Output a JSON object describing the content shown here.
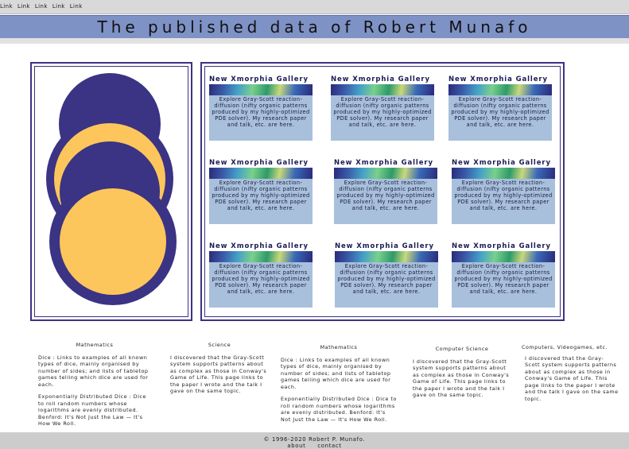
{
  "nav": {
    "links": [
      "Link",
      "Link",
      "Link",
      "Link",
      "Link"
    ]
  },
  "header": {
    "title": "The published data of Robert Munafo"
  },
  "palette": {
    "navy": "#3b3383",
    "gold": "#fcc65c",
    "banner": "#7e92c6",
    "card": "#a8c0dc"
  },
  "gallery": {
    "cards": [
      {
        "title": "New Xmorphia Gallery",
        "text": "Explore Gray-Scott reaction-diffusion (nifty organic patterns produced by my highly-optimized PDE solver). My research paper and talk, etc. are here."
      },
      {
        "title": "New Xmorphia Gallery",
        "text": "Explore Gray-Scott reaction-diffusion (nifty organic patterns produced by my highly-optimized PDE solver). My research paper and talk, etc. are here."
      },
      {
        "title": "New Xmorphia Gallery",
        "text": "Explore Gray-Scott reaction-diffusion (nifty organic patterns produced by my highly-optimized PDE solver). My research paper and talk, etc. are here."
      },
      {
        "title": "New Xmorphia Gallery",
        "text": "Explore Gray-Scott reaction-diffusion (nifty organic patterns produced by my highly-optimized PDE solver). My research paper and talk, etc. are here."
      },
      {
        "title": "New Xmorphia Gallery",
        "text": "Explore Gray-Scott reaction-diffusion (nifty organic patterns produced by my highly-optimized PDE solver). My research paper and talk, etc. are here."
      },
      {
        "title": "New Xmorphia Gallery",
        "text": "Explore Gray-Scott reaction-diffusion (nifty organic patterns produced by my highly-optimized PDE solver). My research paper and talk, etc. are here."
      },
      {
        "title": "New Xmorphia Gallery",
        "text": "Explore Gray-Scott reaction-diffusion (nifty organic patterns produced by my highly-optimized PDE solver). My research paper and talk, etc. are here."
      },
      {
        "title": "New Xmorphia Gallery",
        "text": "Explore Gray-Scott reaction-diffusion (nifty organic patterns produced by my highly-optimized PDE solver). My research paper and talk, etc. are here."
      },
      {
        "title": "New Xmorphia Gallery",
        "text": "Explore Gray-Scott reaction-diffusion (nifty organic patterns produced by my highly-optimized PDE solver). My research paper and talk, etc. are here."
      }
    ]
  },
  "columns": [
    {
      "heading": "Mathematics",
      "p1": "Dice : Links to examples of all known types of dice, mainly organised by number of sides; and lists of tabletop games telling which dice are used for each.",
      "p2": "Exponentially Distributed Dice : Dice to roll random numbers whose logarithms are evenly distributed. Benford: It's Not Just the Law — It's How We Roll."
    },
    {
      "heading": "Science",
      "p1": "I discovered that the Gray-Scott system supports patterns about as complex as those in Conway's Game of Life. This page links to the paper I wrote and the talk I gave on the same topic.",
      "p2": ""
    },
    {
      "heading": "Mathematics",
      "p1": "Dice : Links to examples of all known types of dice, mainly organised by number of sides; and lists of tabletop games telling which dice are used for each.",
      "p2": "Exponentially Distributed Dice : Dice to roll random numbers whose logarithms are evenly distributed. Benford: It's Not Just the Law — It's How We Roll."
    },
    {
      "heading": "Computer Science",
      "p1": "I discovered that the Gray-Scott system supports patterns about as complex as those in Conway's Game of Life. This page links to the paper I wrote and the talk I gave on the same topic.",
      "p2": ""
    },
    {
      "heading": "Computers, Videogames, etc.",
      "p1": "I discovered that the Gray-Scott system supports patterns about as complex as those in Conway's Game of Life. This page links to the paper I wrote and the talk I gave on the same topic.",
      "p2": ""
    }
  ],
  "footer": {
    "copyright": "© 1996-2020 Robert P. Munafo.",
    "about": "about",
    "contact": "contact"
  }
}
